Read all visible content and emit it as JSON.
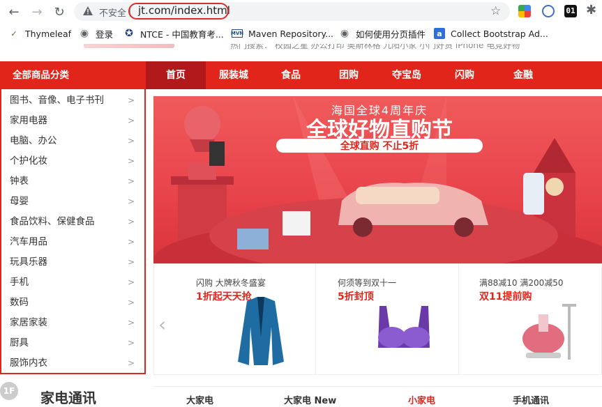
{
  "browser": {
    "insecure_label": "不安全",
    "url": "jt.com/index.html",
    "ext_badge": "01"
  },
  "bookmarks": [
    {
      "label": "Thymeleaf"
    },
    {
      "label": "登录"
    },
    {
      "label": "NTCE - 中国教育考..."
    },
    {
      "label": "Maven Repository..."
    },
    {
      "label": "如何使用分页插件"
    },
    {
      "label": "Collect Bootstrap Ad..."
    }
  ],
  "page": {
    "top_strip_text": "热门搜索：  校园之星   办公打印   奥斯林格   九阳小家   小门好货   iPhone   电竞好物",
    "category_title": "全部商品分类",
    "nav": [
      "首页",
      "服装城",
      "食品",
      "团购",
      "夺宝岛",
      "闪购",
      "金融"
    ],
    "categories": [
      "图书、音像、电子书刊",
      "家用电器",
      "电脑、办公",
      "个护化妆",
      "钟表",
      "母婴",
      "食品饮料、保健食品",
      "汽车用品",
      "玩具乐器",
      "手机",
      "数码",
      "家居家装",
      "厨具",
      "服饰内衣"
    ],
    "banner": {
      "top_line": "海国全球4周年庆",
      "headline": "全球好物直购节",
      "pill": "全球直购  不止5折"
    },
    "promos": [
      {
        "sub": "闪购    大牌秋冬盛宴",
        "title": "1折起天天抢"
      },
      {
        "sub": "何须等到双十一",
        "title": "5折封顶"
      },
      {
        "sub": "满88减10  满200减50",
        "title": "双11提前购"
      }
    ],
    "floor": {
      "badge": "1F",
      "title": "家电通讯",
      "tabs": [
        "大家电",
        "大家电 New",
        "小家电",
        "手机通讯"
      ]
    }
  },
  "colors": {
    "brand_red": "#e1251b",
    "nav_active": "#b1191a"
  }
}
